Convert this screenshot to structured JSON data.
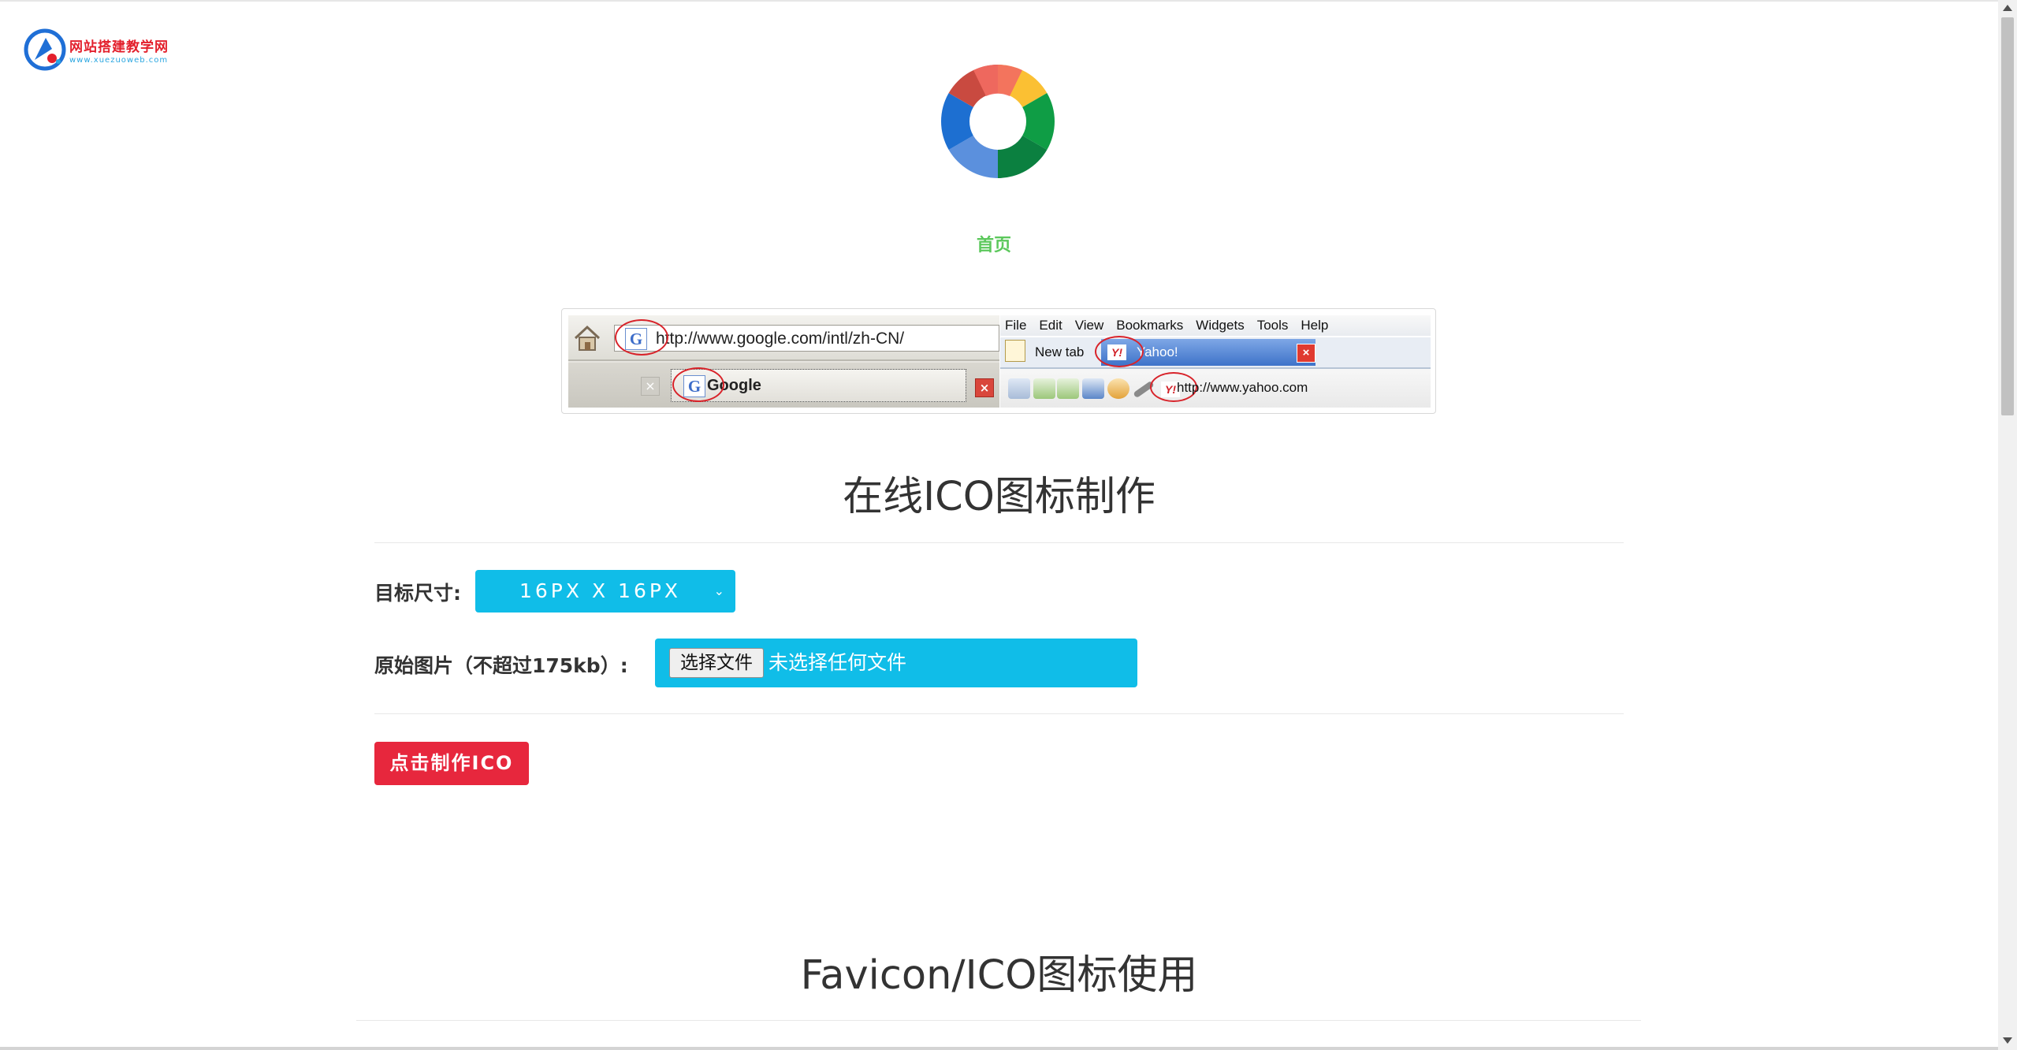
{
  "logo": {
    "title": "网站搭建教学网",
    "url_text": "www.xuezuoweb.com"
  },
  "nav": {
    "home_label": "首页"
  },
  "demo": {
    "google_url": "http://www.google.com/intl/zh-CN/",
    "google_tab": "Google",
    "menu": [
      "File",
      "Edit",
      "View",
      "Bookmarks",
      "Widgets",
      "Tools",
      "Help"
    ],
    "new_tab": "New tab",
    "yahoo_tab": "Yahoo!",
    "yahoo_url": "http://www.yahoo.com"
  },
  "main": {
    "title": "在线ICO图标制作",
    "size_label": "目标尺寸:",
    "size_value": "16PX X 16PX",
    "file_label": "原始图片（不超过175kb）:",
    "file_button": "选择文件",
    "file_status": "未选择任何文件",
    "submit_label": "点击制作ICO"
  },
  "section2": {
    "title": "Favicon/ICO图标使用"
  },
  "colors": {
    "accent_cyan": "#10bde8",
    "submit_red": "#e7273d",
    "home_green": "#5cc85c"
  }
}
